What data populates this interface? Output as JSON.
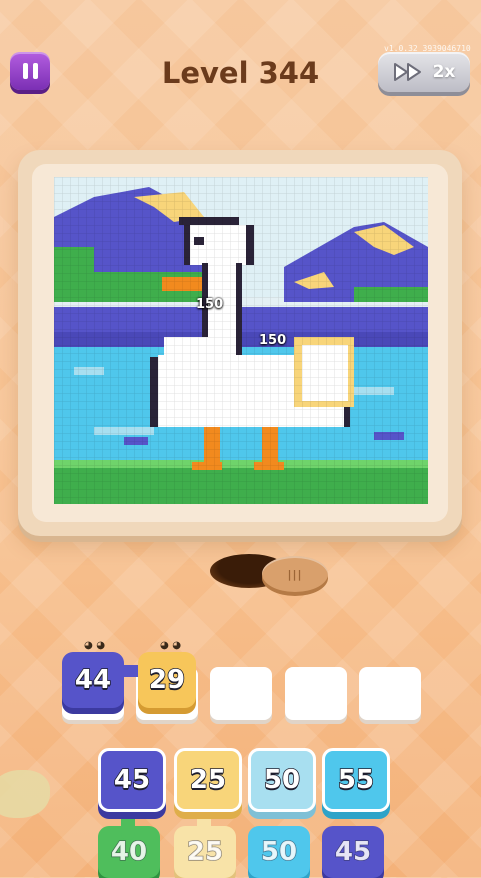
{
  "hud": {
    "level_title": "Level 344",
    "version": "v1.0.32_3939046710",
    "speed_label": "2x"
  },
  "picture": {
    "floating_labels": [
      "150",
      "150"
    ]
  },
  "queue_slots": [
    {
      "value": "44",
      "color": "#5654c9",
      "filled": true
    },
    {
      "value": "29",
      "color": "#f7c65a",
      "filled": true
    },
    {
      "value": "",
      "filled": false
    },
    {
      "value": "",
      "filled": false
    },
    {
      "value": "",
      "filled": false
    }
  ],
  "shooters_front": [
    {
      "value": "45",
      "color": "#5654c9"
    },
    {
      "value": "25",
      "color": "#f8d57a"
    },
    {
      "value": "50",
      "color": "#a8dff0"
    },
    {
      "value": "55",
      "color": "#4fc7ec"
    }
  ],
  "shooters_back": [
    {
      "value": "40",
      "color": "#4fbe5c"
    },
    {
      "value": "25",
      "color": "#f8d57a"
    },
    {
      "value": "50",
      "color": "#4fc7ec"
    },
    {
      "value": "45",
      "color": "#5654c9"
    }
  ],
  "lid": {
    "mark": "|||"
  },
  "colors": {
    "purple": "#5654c9",
    "yellow": "#f8d57a",
    "light_blue": "#a8dff0",
    "cyan": "#4fc7ec",
    "green": "#4fbe5c",
    "orange": "#f28a1e"
  }
}
